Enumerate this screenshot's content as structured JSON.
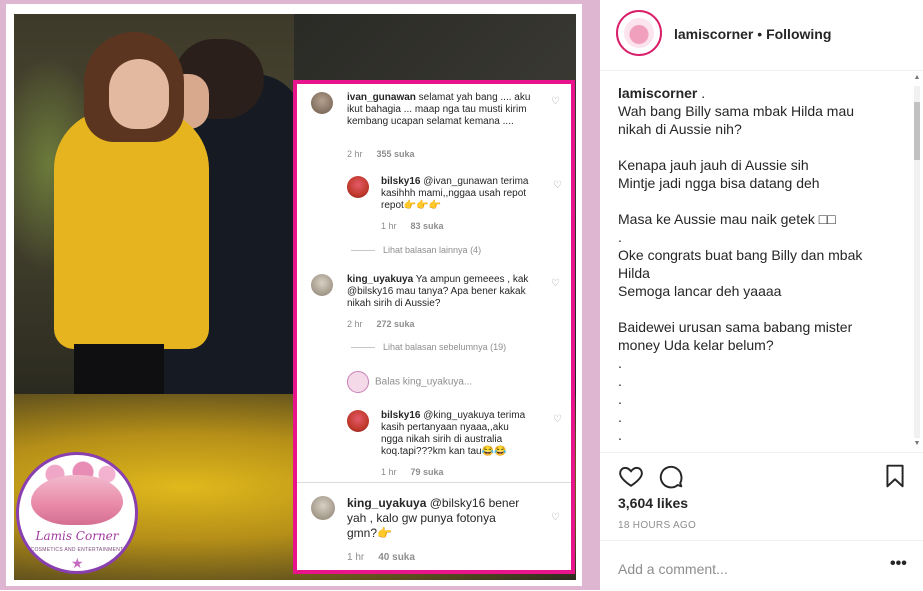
{
  "post": {
    "username": "lamiscorner",
    "separator": "•",
    "follow_state": "Following",
    "caption_lines": [
      "Wah bang Billy sama mbak Hilda mau",
      "nikah di Aussie nih?",
      "",
      "Kenapa jauh jauh di Aussie sih",
      "Mintje jadi ngga bisa datang deh",
      "",
      "Masa ke Aussie mau naik getek □□",
      ".",
      "Oke congrats buat bang Billy dan mbak",
      "Hilda",
      "Semoga lancar deh yaaaa",
      "",
      "Baidewei urusan sama babang mister",
      "money Uda kelar belum?",
      ".",
      ".",
      ".",
      ".",
      "."
    ],
    "caption_user_suffix": " .",
    "likes": "3,604 likes",
    "time": "18 HOURS AGO",
    "add_comment_placeholder": "Add a comment...",
    "more_label": "•••"
  },
  "image_overlay": {
    "logo_name": "Lamis Corner",
    "logo_sub": "COSMETICS AND ENTERTAINMENT",
    "comments": [
      {
        "user": "ivan_gunawan",
        "text": " selamat yah bang .... aku ikut bahagia ... maap nga tau musti kirim kembang ucapan selamat kemana ....",
        "age": "2 hr",
        "likes": "355 suka"
      },
      {
        "user": "bilsky16",
        "text": " @ivan_gunawan terima kasihhh mami,,nggaa usah repot repot👉👉👉",
        "age": "1 hr",
        "likes": "83 suka"
      },
      {
        "user": "king_uyakuya",
        "text": " Ya ampun gemeees , kak @bilsky16 mau tanya? Apa bener kakak nikah sirih di Aussie?",
        "age": "2 hr",
        "likes": "272 suka"
      },
      {
        "user": "bilsky16",
        "text": " @king_uyakuya terima kasih pertanyaan nyaaa,,aku ngga nikah sirih di australia koq.tapi???km kan tau😂😂",
        "age": "1 hr",
        "likes": "79 suka"
      },
      {
        "user": "king_uyakuya",
        "text": " @bilsky16 bener yah , kalo gw punya fotonya gmn?👉",
        "age": "1 hr",
        "likes": "40 suka"
      }
    ],
    "more_replies_1": "Lihat balasan lainnya (4)",
    "more_replies_2": "Lihat balasan sebelumnya (19)",
    "reply_placeholder": "Balas king_uyakuya..."
  },
  "colors": {
    "frame_pink": "#dfb6d2",
    "highlight_magenta": "#e8148c",
    "muted_text": "#8e8e8e"
  },
  "icons": [
    "heart-icon",
    "comment-icon",
    "bookmark-icon",
    "more-options-icon"
  ]
}
